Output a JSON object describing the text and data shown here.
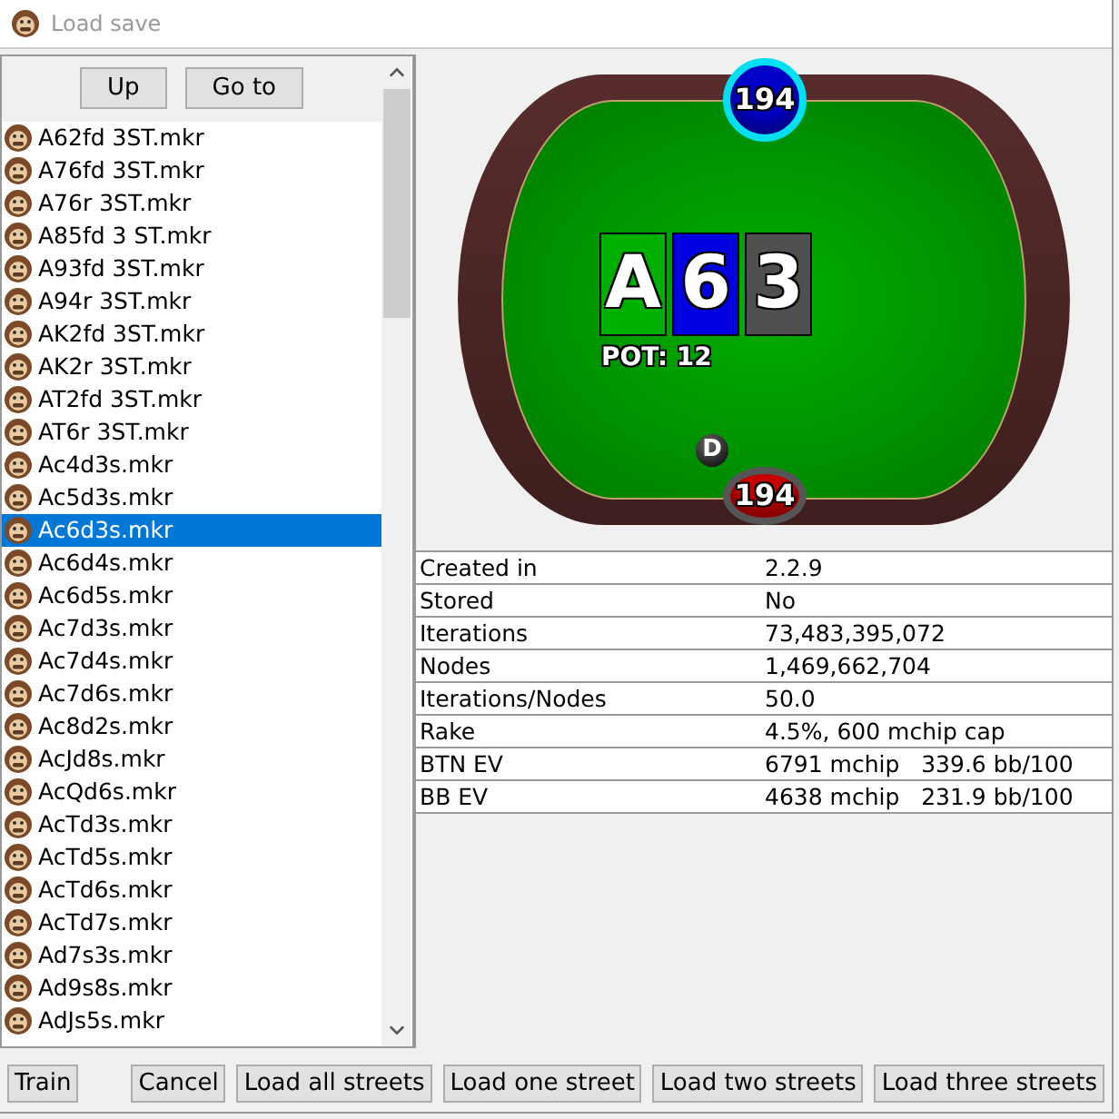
{
  "window": {
    "title": "Load save"
  },
  "nav_buttons": [
    "Up",
    "Go to"
  ],
  "files": [
    {
      "name": "A62fd 3ST.mkr",
      "selected": false
    },
    {
      "name": "A76fd 3ST.mkr",
      "selected": false
    },
    {
      "name": "A76r 3ST.mkr",
      "selected": false
    },
    {
      "name": "A85fd 3 ST.mkr",
      "selected": false
    },
    {
      "name": "A93fd 3ST.mkr",
      "selected": false
    },
    {
      "name": "A94r 3ST.mkr",
      "selected": false
    },
    {
      "name": "AK2fd 3ST.mkr",
      "selected": false
    },
    {
      "name": "AK2r 3ST.mkr",
      "selected": false
    },
    {
      "name": "AT2fd 3ST.mkr",
      "selected": false
    },
    {
      "name": "AT6r 3ST.mkr",
      "selected": false
    },
    {
      "name": "Ac4d3s.mkr",
      "selected": false
    },
    {
      "name": "Ac5d3s.mkr",
      "selected": false
    },
    {
      "name": "Ac6d3s.mkr",
      "selected": true
    },
    {
      "name": "Ac6d4s.mkr",
      "selected": false
    },
    {
      "name": "Ac6d5s.mkr",
      "selected": false
    },
    {
      "name": "Ac7d3s.mkr",
      "selected": false
    },
    {
      "name": "Ac7d4s.mkr",
      "selected": false
    },
    {
      "name": "Ac7d6s.mkr",
      "selected": false
    },
    {
      "name": "Ac8d2s.mkr",
      "selected": false
    },
    {
      "name": "AcJd8s.mkr",
      "selected": false
    },
    {
      "name": "AcQd6s.mkr",
      "selected": false
    },
    {
      "name": "AcTd3s.mkr",
      "selected": false
    },
    {
      "name": "AcTd5s.mkr",
      "selected": false
    },
    {
      "name": "AcTd6s.mkr",
      "selected": false
    },
    {
      "name": "AcTd7s.mkr",
      "selected": false
    },
    {
      "name": "Ad7s3s.mkr",
      "selected": false
    },
    {
      "name": "Ad9s8s.mkr",
      "selected": false
    },
    {
      "name": "AdJs5s.mkr",
      "selected": false
    }
  ],
  "poker_table": {
    "seats": [
      {
        "stack": "194",
        "color": "#0000c8",
        "active": true,
        "dealer": false
      },
      {
        "stack": "194",
        "color": "#c80000",
        "active": false,
        "dealer": true
      }
    ],
    "dealer_label": "D",
    "board": [
      {
        "rank": "A",
        "color": "#00b000"
      },
      {
        "rank": "6",
        "color": "#0000e0"
      },
      {
        "rank": "3",
        "color": "#505050"
      }
    ],
    "pot": "POT: 12"
  },
  "info": [
    {
      "label": "Created in",
      "value": "2.2.9"
    },
    {
      "label": "Stored",
      "value": "No"
    },
    {
      "label": "Iterations",
      "value": "73,483,395,072"
    },
    {
      "label": "Nodes",
      "value": "1,469,662,704"
    },
    {
      "label": "Iterations/Nodes",
      "value": "50.0"
    },
    {
      "label": "Rake",
      "value": "4.5%, 600 mchip cap"
    },
    {
      "label": "BTN EV",
      "value": "6791 mchip   339.6 bb/100"
    },
    {
      "label": "BB EV",
      "value": "4638 mchip   231.9 bb/100"
    }
  ],
  "left_buttons": [
    "Train"
  ],
  "buttons": [
    "Cancel",
    "Load all streets",
    "Load one street",
    "Load two streets",
    "Load three streets"
  ]
}
